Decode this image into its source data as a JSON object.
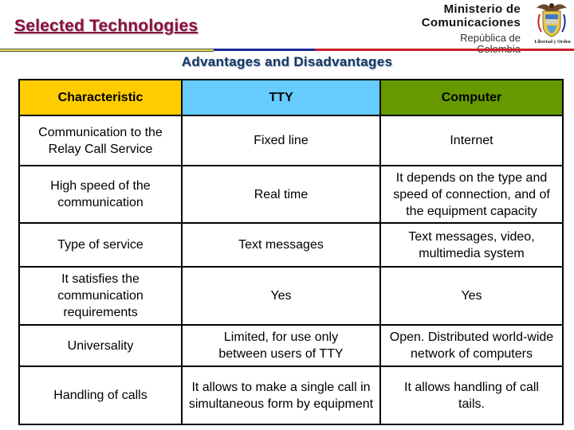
{
  "header": {
    "title": "Selected Technologies",
    "ministry_line1": "Ministerio de",
    "ministry_line2": "Comunicaciones",
    "republic_line1": "República de",
    "republic_line2": "Colombia",
    "emblem_icon": "colombia-coat-of-arms-icon",
    "emblem_motto": "Libertad y Orden",
    "stripe_colors": [
      "#e8e040",
      "#1a2a9a",
      "#c8202a"
    ]
  },
  "subtitle": "Advantages and Disadvantages",
  "table": {
    "columns": [
      {
        "label": "Characteristic",
        "color": "#ffcc00"
      },
      {
        "label": "TTY",
        "color": "#66ccff"
      },
      {
        "label": "Computer",
        "color": "#669900"
      }
    ],
    "rows": [
      {
        "characteristic": "Communication to the Relay Call Service",
        "tty": "Fixed line",
        "computer": "Internet"
      },
      {
        "characteristic": "High speed of the communication",
        "tty": "Real time",
        "computer": "It depends on the type and speed of connection, and of the equipment capacity"
      },
      {
        "characteristic": "Type of service",
        "tty": "Text messages",
        "computer": "Text messages, video, multimedia system"
      },
      {
        "characteristic": "It satisfies the communication requirements",
        "tty": "Yes",
        "computer": "Yes"
      },
      {
        "characteristic": "Universality",
        "tty": "Limited, for use only between users of TTY",
        "computer": "Open. Distributed world-wide network of computers"
      },
      {
        "characteristic": "Handling of calls",
        "tty": "It allows to make a single call in simultaneous form by equipment",
        "computer": "It allows handling of call tails."
      }
    ]
  }
}
